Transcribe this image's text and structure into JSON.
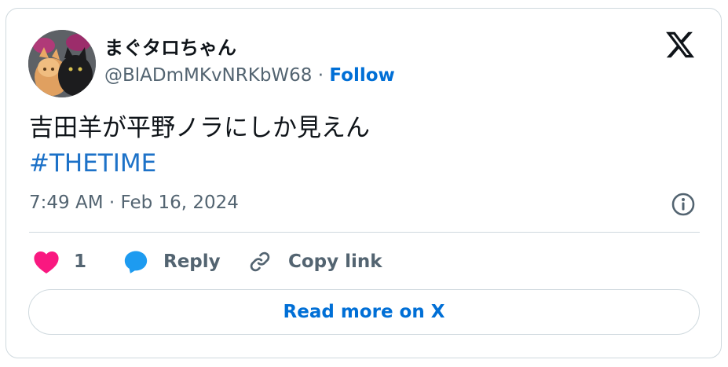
{
  "tweet": {
    "display_name": "まぐタロちゃん",
    "handle": "@BlADmMKvNRKbW68",
    "separator": " · ",
    "follow_label": "Follow",
    "text": "吉田羊が平野ノラにしか見えん",
    "hashtag": "#THETIME",
    "timestamp": "7:49 AM · Feb 16, 2024"
  },
  "actions": {
    "like_count": "1",
    "reply_label": "Reply",
    "copy_link_label": "Copy link"
  },
  "read_more_label": "Read more on X",
  "icons": [
    "avatar",
    "x-logo-icon",
    "info-icon",
    "heart-icon",
    "reply-bubble-icon",
    "link-icon"
  ],
  "colors": {
    "link_blue": "#006fd6",
    "hashtag_blue": "#1d72c8",
    "heart": "#f91880",
    "reply_bubble": "#1d9bf0",
    "muted": "#536471",
    "border": "#cfd9de"
  }
}
